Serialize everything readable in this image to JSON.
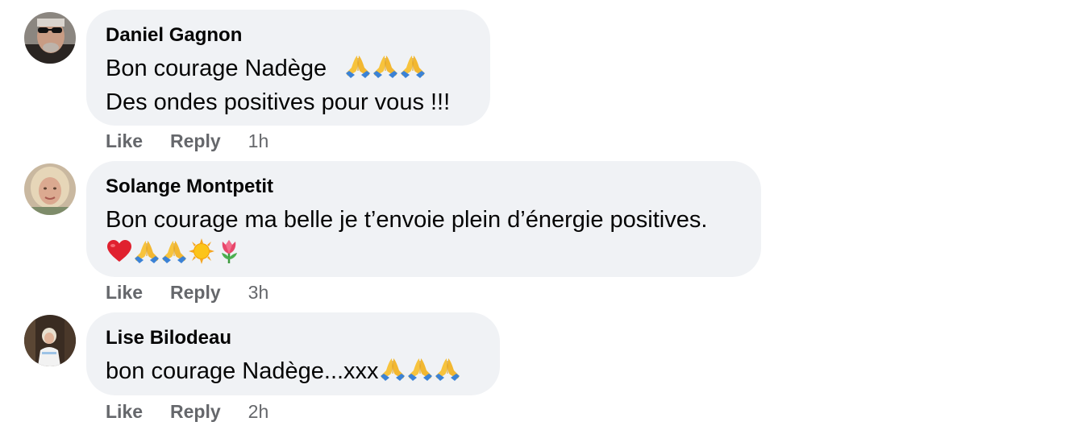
{
  "comments": [
    {
      "author": "Daniel Gagnon",
      "lines": [
        "Bon courage Nadège",
        "Des ondes positives pour vous !!!"
      ],
      "emojis_line1": [
        "folded-hands",
        "folded-hands",
        "folded-hands"
      ],
      "like_label": "Like",
      "reply_label": "Reply",
      "time": "1h"
    },
    {
      "author": "Solange Montpetit",
      "lines": [
        "Bon courage ma belle je t’envoie plein d’énergie positives."
      ],
      "emojis_line2": [
        "red-heart",
        "folded-hands",
        "folded-hands",
        "sun",
        "tulip"
      ],
      "like_label": "Like",
      "reply_label": "Reply",
      "time": "3h"
    },
    {
      "author": "Lise Bilodeau",
      "lines": [
        "bon courage Nadège...xxx"
      ],
      "emojis_line1": [
        "folded-hands",
        "folded-hands",
        "folded-hands"
      ],
      "like_label": "Like",
      "reply_label": "Reply",
      "time": "2h"
    }
  ],
  "colors": {
    "bubble": "#f0f2f5",
    "meta_text": "#65676b",
    "text": "#050505"
  }
}
